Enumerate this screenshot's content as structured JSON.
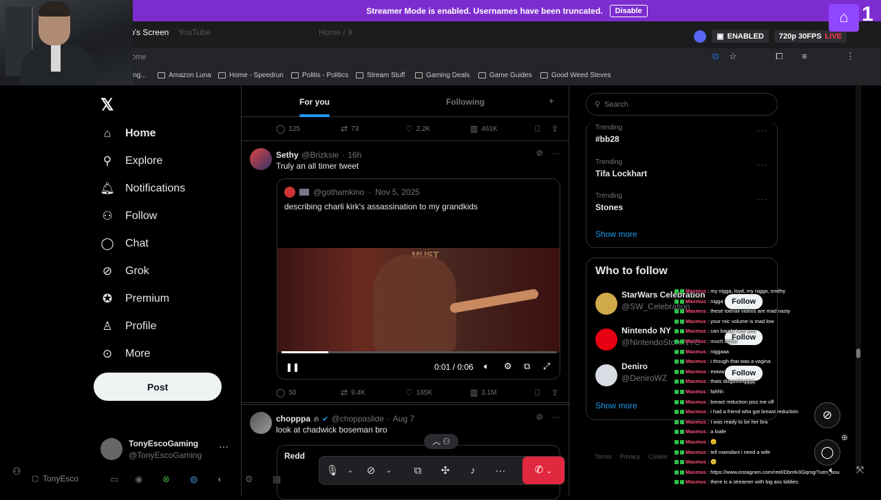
{
  "streamer_banner": {
    "message": "Streamer Mode is enabled. Usernames have been truncated.",
    "disable_label": "Disable"
  },
  "browser": {
    "screen_label": "o's Screen",
    "tabs": [
      "YouTube",
      "Home / X"
    ],
    "url": "ome",
    "bookmarks": [
      "ing...",
      "Amazon Luna",
      "Home - Speedrun",
      "Politis - Politics",
      "Stream Stuff",
      "Gaming Deals",
      "Game Guides",
      "Good Weed Steves"
    ]
  },
  "stream_status": {
    "enabled_label": "ENABLED",
    "quality_label": "720p 30FPS",
    "live_label": "LIVE",
    "viewer_digit": "1"
  },
  "x_nav": {
    "items": [
      {
        "icon": "home-icon",
        "label": "Home"
      },
      {
        "icon": "explore-icon",
        "label": "Explore"
      },
      {
        "icon": "notifications-icon",
        "label": "Notifications"
      },
      {
        "icon": "follow-icon",
        "label": "Follow"
      },
      {
        "icon": "chat-icon",
        "label": "Chat"
      },
      {
        "icon": "grok-icon",
        "label": "Grok"
      },
      {
        "icon": "premium-icon",
        "label": "Premium"
      },
      {
        "icon": "profile-icon",
        "label": "Profile"
      },
      {
        "icon": "more-icon",
        "label": "More"
      }
    ],
    "post_label": "Post",
    "account": {
      "name": "TonyEscoGaming",
      "handle": "@TonyEscoGaming"
    }
  },
  "feed": {
    "tabs": {
      "for_you": "For you",
      "following": "Following"
    },
    "top_actions": {
      "replies": "125",
      "reposts": "73",
      "likes": "2.2K",
      "views": "461K"
    },
    "tweet1": {
      "name": "Sethy",
      "handle": "@Brizksie",
      "time": "16h",
      "text": "Truly an all timer tweet",
      "quote": {
        "handle": "@gothamkino",
        "date": "Nov 5, 2025",
        "text": "describing charli kirk's assassination to my grandkids"
      },
      "video": {
        "time": "0:01 / 0:06",
        "progress": 0.17,
        "overlay_text": "MUST"
      },
      "actions": {
        "replies": "50",
        "reposts": "9.4K",
        "likes": "165K",
        "views": "3.1M"
      }
    },
    "tweet2": {
      "name": "chopppa",
      "handle": "@choppaslide",
      "time": "Aug 7",
      "text": "look at chadwick boseman bro",
      "quote_name": "Redd"
    }
  },
  "right_panel": {
    "search_placeholder": "Search",
    "trends": [
      {
        "category": "Trending",
        "title": "#bb28"
      },
      {
        "category": "Trending",
        "title": "Tifa Lockhart"
      },
      {
        "category": "Trending",
        "title": "Stones"
      }
    ],
    "show_more": "Show more",
    "who_to_follow_title": "Who to follow",
    "who_to_follow": [
      {
        "name": "StarWars Celebration",
        "handle": "@SW_Celebration",
        "color": "#cfa94a"
      },
      {
        "name": "Nintendo NY",
        "handle": "@NintendoStoreNYC",
        "color": "#e60012"
      },
      {
        "name": "Deniro",
        "handle": "@DeniroWZ",
        "color": "#d8dde3"
      }
    ],
    "follow_label": "Follow",
    "footer": [
      "Terms",
      "Privacy",
      "Cookie"
    ]
  },
  "chat": [
    {
      "user": "Maxmus",
      "msg": ": my nigga, loyd, my nigga, smithy"
    },
    {
      "user": "Maxmus",
      "msg": ": nigga"
    },
    {
      "user": "Maxmus",
      "msg": ": these toenail videos are mad nasty"
    },
    {
      "user": "Maxmus",
      "msg": ": your mic volume is mad low"
    },
    {
      "user": "Maxmus",
      "msg": ": can barely hear you"
    },
    {
      "user": "Maxmus",
      "msg": ": much better"
    },
    {
      "user": "Maxmus",
      "msg": ": niggaaa"
    },
    {
      "user": "Maxmus",
      "msg": ": i though that was a vagina"
    },
    {
      "user": "Maxmus",
      "msg": ": ewww"
    },
    {
      "user": "Maxmus",
      "msg": ": thats disgustingggg"
    },
    {
      "user": "Maxmus",
      "msg": ": fahhh"
    },
    {
      "user": "Maxmus",
      "msg": ": breast reduction piss me off"
    },
    {
      "user": "Maxmus",
      "msg": ": i had a friend who got breast reduction"
    },
    {
      "user": "Maxmus",
      "msg": ": I was ready to be her bra"
    },
    {
      "user": "Maxmus",
      "msg": ": a loafe"
    },
    {
      "user": "Maxmus",
      "msg": ": 😐"
    },
    {
      "user": "Maxmus",
      "msg": ": tell mamdani i need a wife"
    },
    {
      "user": "Maxmus",
      "msg": ": 🥺"
    },
    {
      "user": "Maxmus",
      "msg": ": https://www.instagram.com/reel/Dbmlv3Gqmg/?utm_source=ig_web_copy_link&igsh=MzRlODBiNWFlZA=="
    },
    {
      "user": "Maxmus",
      "msg": ": there is a streamer with big ass tiddies"
    }
  ],
  "taskbar": {
    "user_label": "TonyEsco"
  },
  "colors": {
    "accent": "#1d9bf0",
    "banner": "#7d2ccf",
    "end_call": "#e0283f",
    "chat_name": "#ff4f7b"
  }
}
